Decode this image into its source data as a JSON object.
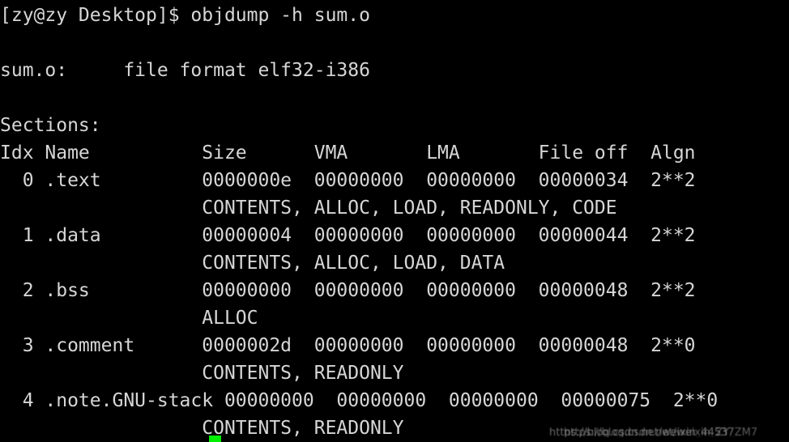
{
  "terminal": {
    "background_color": "#000000",
    "text_color": "#d6d6d6",
    "cursor_color": "#00ee00",
    "prompt": "[zy@zy Desktop]$",
    "command": "objdump -h sum.o",
    "prompt_line": "[zy@zy Desktop]$ objdump -h sum.o",
    "file_format_line": "sum.o:     file format elf32-i386",
    "file_name": "sum.o:",
    "file_format": "file format elf32-i386",
    "sections_label": "Sections:",
    "header_line": "Idx Name          Size      VMA       LMA       File off  Algn",
    "columns": [
      "Idx",
      "Name",
      "Size",
      "VMA",
      "LMA",
      "File off",
      "Algn"
    ],
    "sections": [
      {
        "idx": "0",
        "name": ".text",
        "size": "0000000e",
        "vma": "00000000",
        "lma": "00000000",
        "file_off": "00000034",
        "algn": "2**2",
        "row_line": "  0 .text         0000000e  00000000  00000000  00000034  2**2",
        "flags": "CONTENTS, ALLOC, LOAD, READONLY, CODE",
        "flags_line": "                  CONTENTS, ALLOC, LOAD, READONLY, CODE"
      },
      {
        "idx": "1",
        "name": ".data",
        "size": "00000004",
        "vma": "00000000",
        "lma": "00000000",
        "file_off": "00000044",
        "algn": "2**2",
        "row_line": "  1 .data         00000004  00000000  00000000  00000044  2**2",
        "flags": "CONTENTS, ALLOC, LOAD, DATA",
        "flags_line": "                  CONTENTS, ALLOC, LOAD, DATA"
      },
      {
        "idx": "2",
        "name": ".bss",
        "size": "00000000",
        "vma": "00000000",
        "lma": "00000000",
        "file_off": "00000048",
        "algn": "2**2",
        "row_line": "  2 .bss          00000000  00000000  00000000  00000048  2**2",
        "flags": "ALLOC",
        "flags_line": "                  ALLOC"
      },
      {
        "idx": "3",
        "name": ".comment",
        "size": "0000002d",
        "vma": "00000000",
        "lma": "00000000",
        "file_off": "00000048",
        "algn": "2**0",
        "row_line": "  3 .comment      0000002d  00000000  00000000  00000048  2**0",
        "flags": "CONTENTS, READONLY",
        "flags_line": "                  CONTENTS, READONLY"
      },
      {
        "idx": "4",
        "name": ".note.GNU-stack",
        "size": "00000000",
        "vma": "00000000",
        "lma": "00000000",
        "file_off": "00000075",
        "algn": "2**0",
        "row_line": "  4 .note.GNU-stack 00000000  00000000  00000000  00000075  2**0",
        "flags": "CONTENTS, READONLY",
        "flags_line": "                  CONTENTS, READONLY"
      }
    ]
  },
  "watermark": {
    "text_a": "https://blog.csdn.net/weixin_44537",
    "text_b": "https://blog.csdn.net/weixin_ZY_ZM7"
  }
}
